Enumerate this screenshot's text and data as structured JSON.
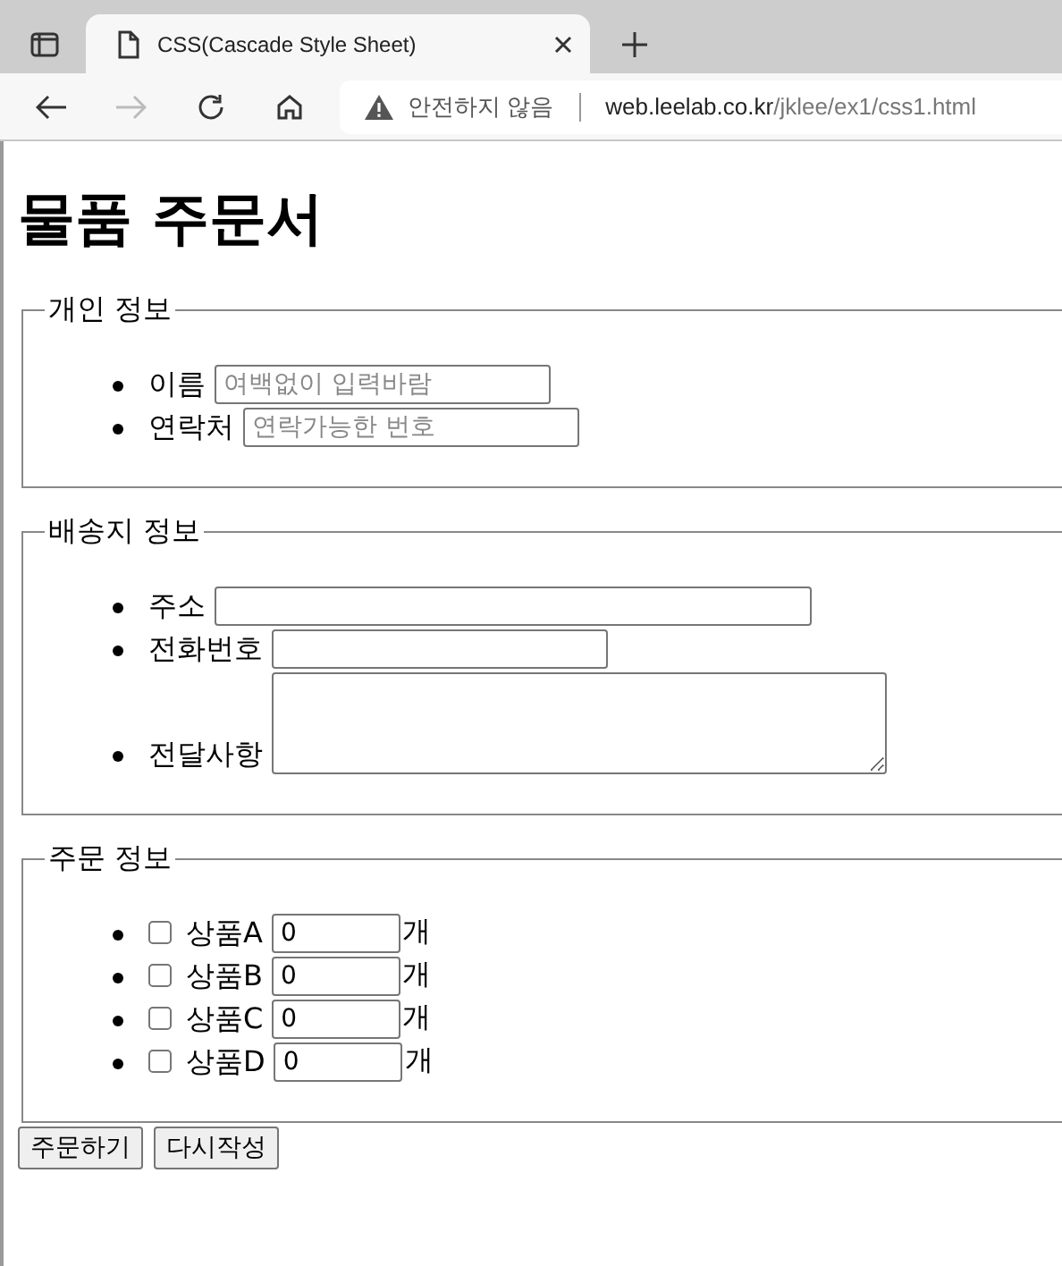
{
  "browser": {
    "tab_title": "CSS(Cascade Style Sheet)",
    "security": "안전하지 않음",
    "url_host": "web.leelab.co.kr",
    "url_path": "/jklee/ex1/css1.html"
  },
  "heading": "물품 주문서",
  "sections": [
    {
      "legend": "개인 정보",
      "fields": [
        {
          "kind": "text",
          "label": "이름",
          "placeholder": "여백없이 입력바람"
        },
        {
          "kind": "text",
          "label": "연락처",
          "placeholder": "연락가능한 번호"
        }
      ]
    },
    {
      "legend": "배송지 정보",
      "fields": [
        {
          "kind": "wide-text",
          "label": "주소"
        },
        {
          "kind": "text",
          "label": "전화번호"
        },
        {
          "kind": "textarea",
          "label": "전달사항"
        }
      ]
    },
    {
      "legend": "주문 정보",
      "fields": [
        {
          "kind": "product",
          "label": "상품A",
          "checked": false,
          "value": "0",
          "unit": "개"
        },
        {
          "kind": "product",
          "label": "상품B",
          "checked": false,
          "value": "0",
          "unit": "개"
        },
        {
          "kind": "product",
          "label": "상품C",
          "checked": false,
          "value": "0",
          "unit": "개"
        },
        {
          "kind": "product",
          "label": "상품D",
          "checked": false,
          "value": "0",
          "unit": "개"
        }
      ]
    }
  ],
  "buttons": [
    "주문하기",
    "다시작성"
  ]
}
